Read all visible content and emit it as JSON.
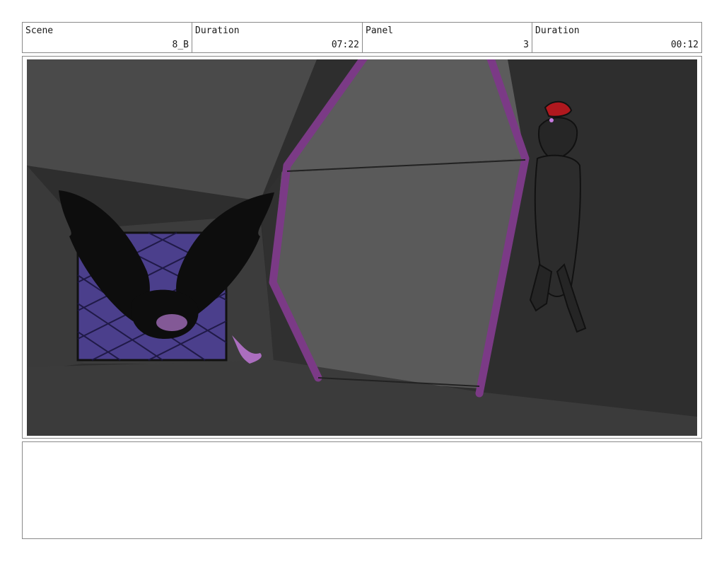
{
  "header": {
    "scene": {
      "label": "Scene",
      "value": "8_B"
    },
    "scene_duration": {
      "label": "Duration",
      "value": "07:22"
    },
    "panel": {
      "label": "Panel",
      "value": "3"
    },
    "panel_duration": {
      "label": "Duration",
      "value": "00:12"
    }
  },
  "colors": {
    "frame_border": "#8a8a8a",
    "portal_purple": "#7b3a86",
    "cage_blue": "#4b3f8c",
    "glow_pink": "#c77be0",
    "hair_red": "#b0181e"
  },
  "notes": {
    "text": ""
  }
}
